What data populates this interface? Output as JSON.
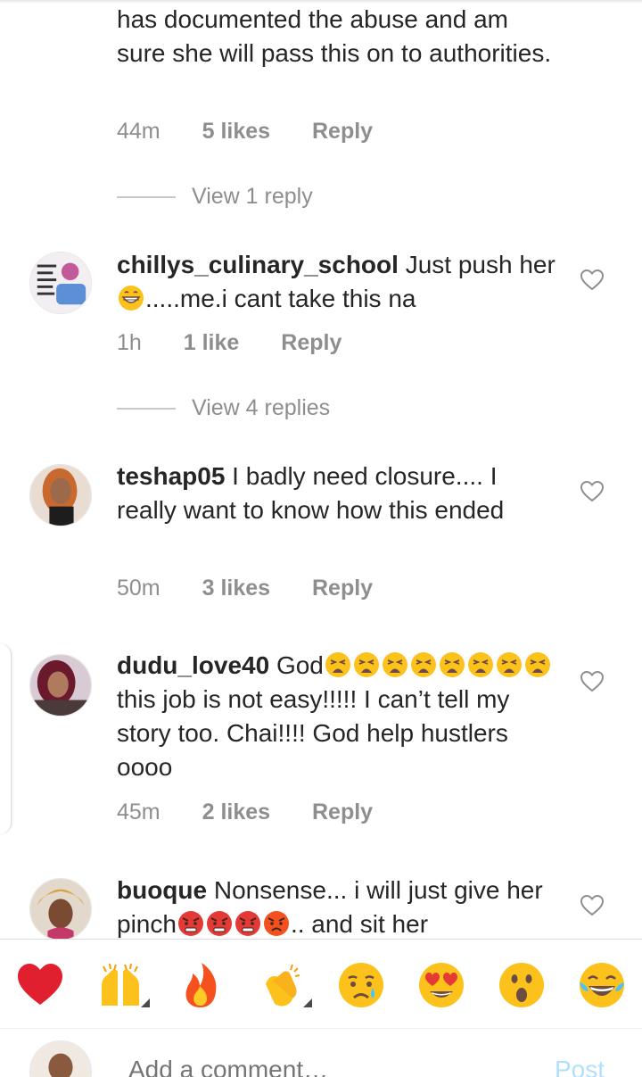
{
  "comments": [
    {
      "text": "has documented the abuse and am sure she will pass this on to authorities.",
      "time": "44m",
      "likes": "5 likes",
      "reply": "Reply",
      "view_replies": "View 1 reply"
    },
    {
      "username": "chillys_culinary_school",
      "text_a": " Just push her",
      "text_b": ".....me.i cant take this na",
      "time": "1h",
      "likes": "1 like",
      "reply": "Reply",
      "view_replies": "View 4 replies"
    },
    {
      "username": "teshap05",
      "text": " I badly need closure.... I really want to know how this ended",
      "time": "50m",
      "likes": "3 likes",
      "reply": "Reply"
    },
    {
      "username": "dudu_love40",
      "text_a": " God",
      "text_b": " this job is not easy!!!!! I can’t tell my story too. Chai!!!! God help hustlers oooo",
      "time": "45m",
      "likes": "2 likes",
      "reply": "Reply"
    },
    {
      "username": "buoque",
      "text_a": " Nonsense... i will just give her pinch",
      "text_b": ".. and sit her"
    }
  ],
  "icons": {
    "heart": "heart-outline-icon",
    "weary": "weary-face-emoji",
    "grin": "grinning-face-emoji",
    "angry": "angry-face-emoji"
  },
  "emoji_bar": [
    "red-heart",
    "raising-hands",
    "fire",
    "clapping-hands",
    "crying-face",
    "heart-eyes",
    "astonished-face",
    "tears-of-joy"
  ],
  "compose": {
    "placeholder": "Add a comment…",
    "post_label": "Post"
  },
  "colors": {
    "text": "#262626",
    "meta": "#8e8e8e",
    "post": "#b2dffc"
  }
}
